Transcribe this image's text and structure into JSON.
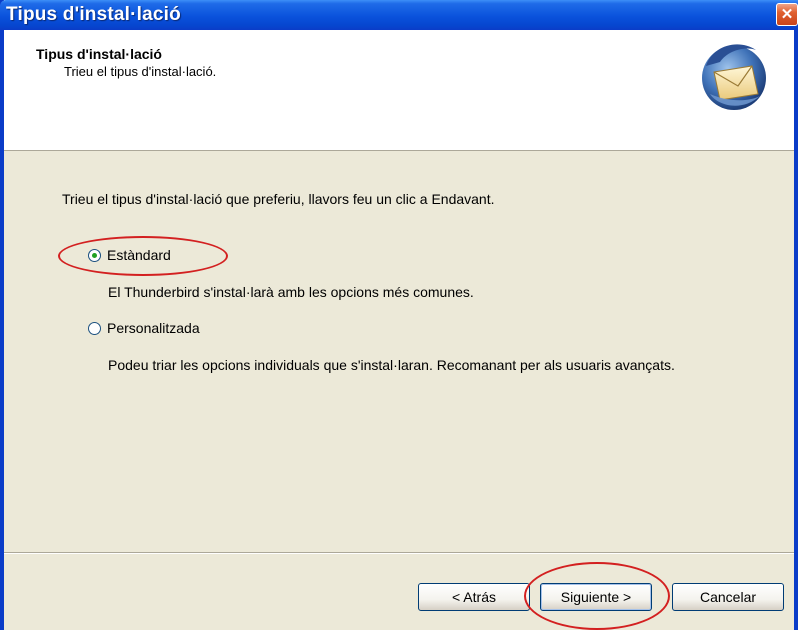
{
  "window": {
    "title": "Tipus d'instal·lació",
    "close_glyph": "✕"
  },
  "header": {
    "title": "Tipus d'instal·lació",
    "subtitle": "Trieu el tipus d'instal·lació.",
    "logo_icon": "thunderbird-logo-icon"
  },
  "content": {
    "instruction": "Trieu el tipus d'instal·lació que preferiu, llavors feu un clic a Endavant.",
    "options": [
      {
        "label": "Estàndard",
        "description": "El Thunderbird s'instal·larà amb les opcions més comunes.",
        "selected": true
      },
      {
        "label": "Personalitzada",
        "description": "Podeu triar les opcions individuals que s'instal·laran. Recomanant per als usuaris avançats.",
        "selected": false
      }
    ]
  },
  "footer": {
    "back_label": "< Atrás",
    "next_label": "Siguiente >",
    "cancel_label": "Cancelar"
  },
  "colors": {
    "titlebar": "#0a52dc",
    "dialog_bg": "#ece9d8",
    "annotation": "#d32020",
    "radio_dot": "#21a121"
  }
}
